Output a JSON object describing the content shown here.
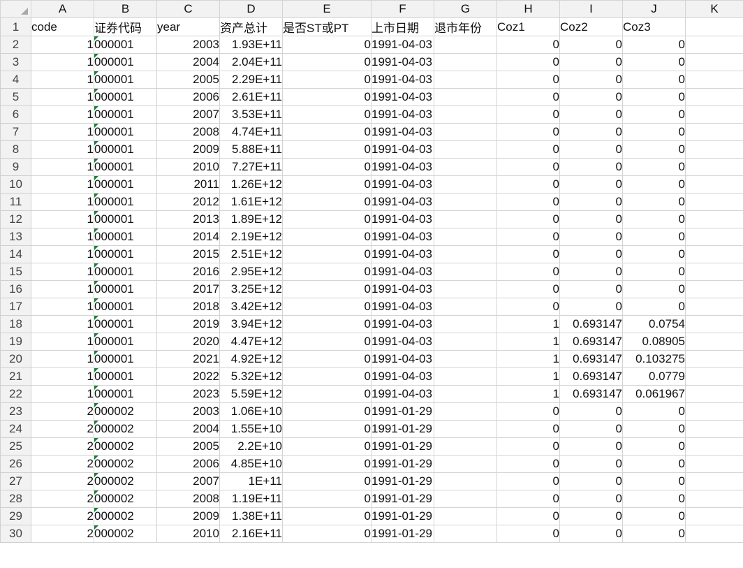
{
  "columns": [
    "A",
    "B",
    "C",
    "D",
    "E",
    "F",
    "G",
    "H",
    "I",
    "J",
    "K"
  ],
  "header_row": {
    "num": "1",
    "cells": [
      "code",
      "证券代码",
      "year",
      "资产总计",
      "是否ST或PT",
      "上市日期",
      "退市年份",
      "Coz1",
      "Coz2",
      "Coz3",
      ""
    ]
  },
  "rows": [
    {
      "num": "2",
      "cells": [
        "1",
        "000001",
        "2003",
        "1.93E+11",
        "0",
        "1991-04-03",
        "",
        "0",
        "0",
        "0",
        ""
      ]
    },
    {
      "num": "3",
      "cells": [
        "1",
        "000001",
        "2004",
        "2.04E+11",
        "0",
        "1991-04-03",
        "",
        "0",
        "0",
        "0",
        ""
      ]
    },
    {
      "num": "4",
      "cells": [
        "1",
        "000001",
        "2005",
        "2.29E+11",
        "0",
        "1991-04-03",
        "",
        "0",
        "0",
        "0",
        ""
      ]
    },
    {
      "num": "5",
      "cells": [
        "1",
        "000001",
        "2006",
        "2.61E+11",
        "0",
        "1991-04-03",
        "",
        "0",
        "0",
        "0",
        ""
      ]
    },
    {
      "num": "6",
      "cells": [
        "1",
        "000001",
        "2007",
        "3.53E+11",
        "0",
        "1991-04-03",
        "",
        "0",
        "0",
        "0",
        ""
      ]
    },
    {
      "num": "7",
      "cells": [
        "1",
        "000001",
        "2008",
        "4.74E+11",
        "0",
        "1991-04-03",
        "",
        "0",
        "0",
        "0",
        ""
      ]
    },
    {
      "num": "8",
      "cells": [
        "1",
        "000001",
        "2009",
        "5.88E+11",
        "0",
        "1991-04-03",
        "",
        "0",
        "0",
        "0",
        ""
      ]
    },
    {
      "num": "9",
      "cells": [
        "1",
        "000001",
        "2010",
        "7.27E+11",
        "0",
        "1991-04-03",
        "",
        "0",
        "0",
        "0",
        ""
      ]
    },
    {
      "num": "10",
      "cells": [
        "1",
        "000001",
        "2011",
        "1.26E+12",
        "0",
        "1991-04-03",
        "",
        "0",
        "0",
        "0",
        ""
      ]
    },
    {
      "num": "11",
      "cells": [
        "1",
        "000001",
        "2012",
        "1.61E+12",
        "0",
        "1991-04-03",
        "",
        "0",
        "0",
        "0",
        ""
      ]
    },
    {
      "num": "12",
      "cells": [
        "1",
        "000001",
        "2013",
        "1.89E+12",
        "0",
        "1991-04-03",
        "",
        "0",
        "0",
        "0",
        ""
      ]
    },
    {
      "num": "13",
      "cells": [
        "1",
        "000001",
        "2014",
        "2.19E+12",
        "0",
        "1991-04-03",
        "",
        "0",
        "0",
        "0",
        ""
      ]
    },
    {
      "num": "14",
      "cells": [
        "1",
        "000001",
        "2015",
        "2.51E+12",
        "0",
        "1991-04-03",
        "",
        "0",
        "0",
        "0",
        ""
      ]
    },
    {
      "num": "15",
      "cells": [
        "1",
        "000001",
        "2016",
        "2.95E+12",
        "0",
        "1991-04-03",
        "",
        "0",
        "0",
        "0",
        ""
      ]
    },
    {
      "num": "16",
      "cells": [
        "1",
        "000001",
        "2017",
        "3.25E+12",
        "0",
        "1991-04-03",
        "",
        "0",
        "0",
        "0",
        ""
      ]
    },
    {
      "num": "17",
      "cells": [
        "1",
        "000001",
        "2018",
        "3.42E+12",
        "0",
        "1991-04-03",
        "",
        "0",
        "0",
        "0",
        ""
      ]
    },
    {
      "num": "18",
      "cells": [
        "1",
        "000001",
        "2019",
        "3.94E+12",
        "0",
        "1991-04-03",
        "",
        "1",
        "0.693147",
        "0.0754",
        ""
      ]
    },
    {
      "num": "19",
      "cells": [
        "1",
        "000001",
        "2020",
        "4.47E+12",
        "0",
        "1991-04-03",
        "",
        "1",
        "0.693147",
        "0.08905",
        ""
      ]
    },
    {
      "num": "20",
      "cells": [
        "1",
        "000001",
        "2021",
        "4.92E+12",
        "0",
        "1991-04-03",
        "",
        "1",
        "0.693147",
        "0.103275",
        ""
      ]
    },
    {
      "num": "21",
      "cells": [
        "1",
        "000001",
        "2022",
        "5.32E+12",
        "0",
        "1991-04-03",
        "",
        "1",
        "0.693147",
        "0.0779",
        ""
      ]
    },
    {
      "num": "22",
      "cells": [
        "1",
        "000001",
        "2023",
        "5.59E+12",
        "0",
        "1991-04-03",
        "",
        "1",
        "0.693147",
        "0.061967",
        ""
      ]
    },
    {
      "num": "23",
      "cells": [
        "2",
        "000002",
        "2003",
        "1.06E+10",
        "0",
        "1991-01-29",
        "",
        "0",
        "0",
        "0",
        ""
      ]
    },
    {
      "num": "24",
      "cells": [
        "2",
        "000002",
        "2004",
        "1.55E+10",
        "0",
        "1991-01-29",
        "",
        "0",
        "0",
        "0",
        ""
      ]
    },
    {
      "num": "25",
      "cells": [
        "2",
        "000002",
        "2005",
        "2.2E+10",
        "0",
        "1991-01-29",
        "",
        "0",
        "0",
        "0",
        ""
      ]
    },
    {
      "num": "26",
      "cells": [
        "2",
        "000002",
        "2006",
        "4.85E+10",
        "0",
        "1991-01-29",
        "",
        "0",
        "0",
        "0",
        ""
      ]
    },
    {
      "num": "27",
      "cells": [
        "2",
        "000002",
        "2007",
        "1E+11",
        "0",
        "1991-01-29",
        "",
        "0",
        "0",
        "0",
        ""
      ]
    },
    {
      "num": "28",
      "cells": [
        "2",
        "000002",
        "2008",
        "1.19E+11",
        "0",
        "1991-01-29",
        "",
        "0",
        "0",
        "0",
        ""
      ]
    },
    {
      "num": "29",
      "cells": [
        "2",
        "000002",
        "2009",
        "1.38E+11",
        "0",
        "1991-01-29",
        "",
        "0",
        "0",
        "0",
        ""
      ]
    },
    {
      "num": "30",
      "cells": [
        "2",
        "000002",
        "2010",
        "2.16E+11",
        "0",
        "1991-01-29",
        "",
        "0",
        "0",
        "0",
        ""
      ]
    }
  ],
  "colors": {
    "header_bg": "#f2f2f2",
    "gridline": "#d4d4d4",
    "text_number_flag": "#1e7b3a"
  },
  "icons": {
    "corner": "select-all-triangle-icon",
    "text_flag": "number-stored-as-text-flag-icon"
  }
}
